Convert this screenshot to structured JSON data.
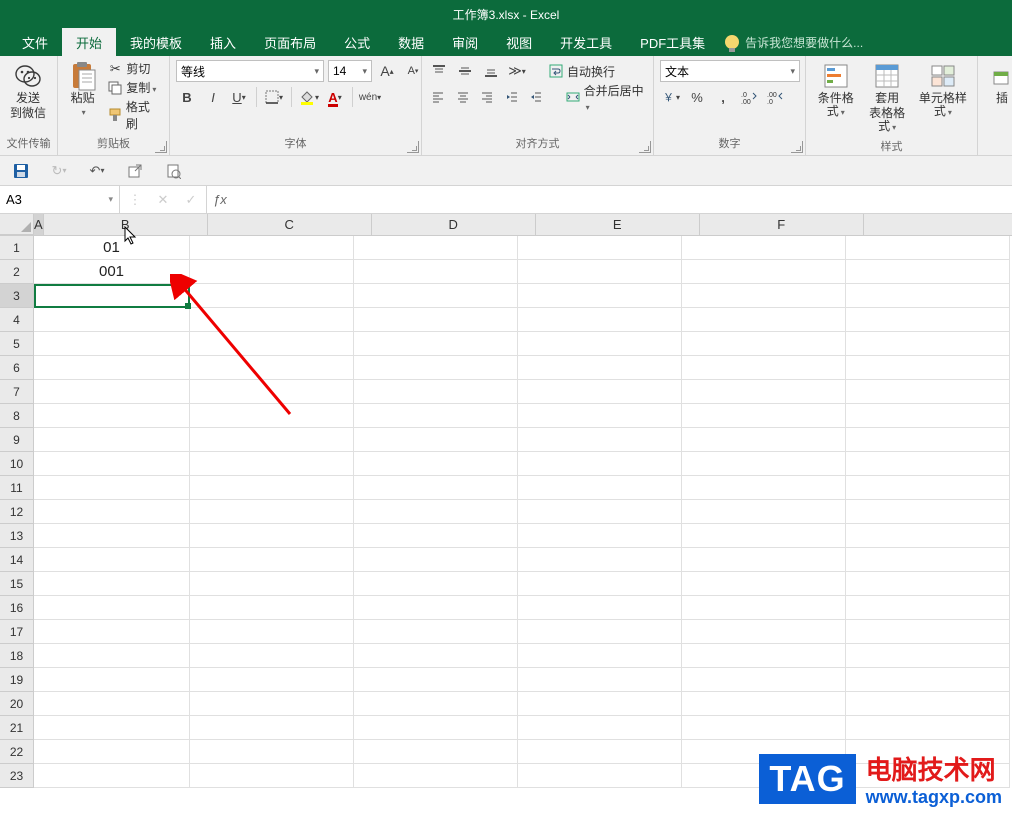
{
  "title": "工作簿3.xlsx - Excel",
  "tabs": [
    "文件",
    "开始",
    "我的模板",
    "插入",
    "页面布局",
    "公式",
    "数据",
    "审阅",
    "视图",
    "开发工具",
    "PDF工具集"
  ],
  "active_tab": 1,
  "tell_me": "告诉我您想要做什么...",
  "groups": {
    "wechat": {
      "send": "发送",
      "to": "到微信",
      "label": "文件传输"
    },
    "clipboard": {
      "paste": "粘贴",
      "cut": "剪切",
      "copy": "复制",
      "format_painter": "格式刷",
      "label": "剪贴板"
    },
    "font": {
      "name": "等线",
      "size": "14",
      "label": "字体"
    },
    "align": {
      "wrap": "自动换行",
      "merge": "合并后居中",
      "label": "对齐方式"
    },
    "number": {
      "format": "文本",
      "label": "数字"
    },
    "styles": {
      "cond": "条件格式",
      "tbl1": "套用",
      "tbl2": "表格格式",
      "cell": "单元格样式",
      "label": "样式"
    },
    "cells": {
      "insert": "插"
    }
  },
  "name_box": "A3",
  "formula": "",
  "columns": [
    "A",
    "B",
    "C",
    "D",
    "E",
    "F"
  ],
  "row_count": 23,
  "cells": {
    "A1": "01",
    "A2": "001"
  },
  "selection": {
    "ref": "A3",
    "col": 0,
    "row": 2
  },
  "watermark": {
    "tag": "TAG",
    "line1": "电脑技术网",
    "line2": "www.tagxp.com"
  }
}
